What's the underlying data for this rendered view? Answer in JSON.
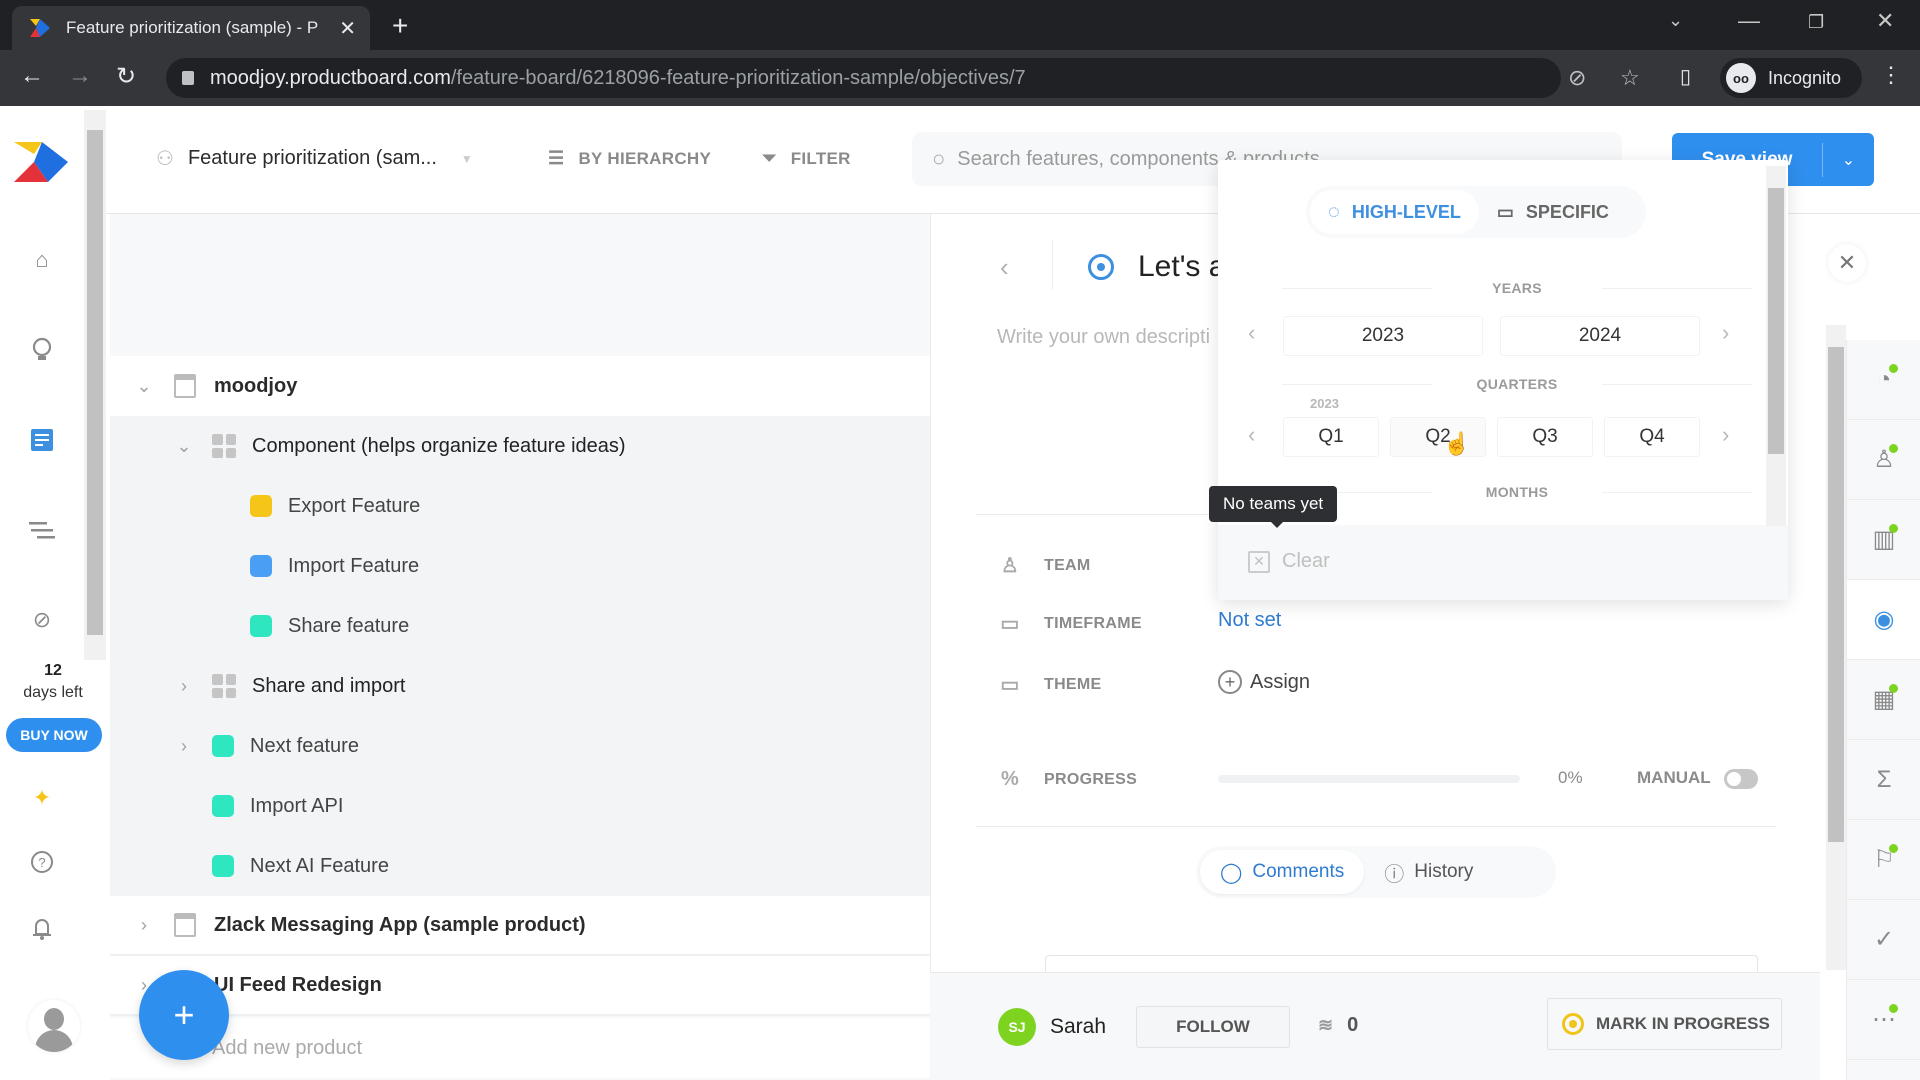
{
  "browser": {
    "tab_title": "Feature prioritization (sample) - P",
    "url_domain": "moodjoy.productboard.com",
    "url_path": "/feature-board/6218096-feature-prioritization-sample/objectives/7",
    "profile_label": "Incognito"
  },
  "rail": {
    "trial_days": "12",
    "trial_label": "days left",
    "buy_label": "BUY NOW"
  },
  "header": {
    "board_name": "Feature prioritization (sam...",
    "hierarchy_label": "BY HIERARCHY",
    "filter_label": "FILTER",
    "search_placeholder": "Search features, components & products",
    "save_view_label": "Save view"
  },
  "tree": {
    "rows": [
      {
        "label": "moodjoy",
        "type": "product",
        "expanded": true
      },
      {
        "label": "Component (helps organize feature ideas)",
        "type": "component",
        "expanded": true
      },
      {
        "label": "Export Feature",
        "type": "feature",
        "color": "#f5c518"
      },
      {
        "label": "Import Feature",
        "type": "feature",
        "color": "#4a9ff5"
      },
      {
        "label": "Share feature",
        "type": "feature",
        "color": "#2ee6c0"
      },
      {
        "label": "Share and import",
        "type": "component",
        "expanded": false
      },
      {
        "label": "Next feature",
        "type": "feature",
        "color": "#2ee6c0",
        "expandable": true
      },
      {
        "label": "Import API",
        "type": "feature",
        "color": "#2ee6c0"
      },
      {
        "label": "Next AI Feature",
        "type": "feature",
        "color": "#2ee6c0"
      },
      {
        "label": "Zlack Messaging App (sample product)",
        "type": "product",
        "expanded": false
      },
      {
        "label": "UI Feed Redesign",
        "type": "product",
        "expanded": false
      }
    ],
    "add_product_label": "Add new product"
  },
  "detail": {
    "title": "Let's a",
    "description_placeholder": "Write your own descripti",
    "fields": {
      "team_label": "TEAM",
      "timeframe_label": "TIMEFRAME",
      "timeframe_value": "Not set",
      "theme_label": "THEME",
      "theme_action": "Assign",
      "progress_label": "PROGRESS",
      "progress_value": "0%",
      "progress_fraction": 0,
      "manual_label": "MANUAL",
      "manual_on": false
    },
    "tabs": {
      "comments": "Comments",
      "history": "History",
      "active": "comments"
    },
    "footer": {
      "user_initials": "SJ",
      "user_name": "Sarah",
      "follow_label": "FOLLOW",
      "votes": "0",
      "mark_label": "MARK IN PROGRESS"
    }
  },
  "timeframe_picker": {
    "modes": {
      "high_level": "HIGH-LEVEL",
      "specific": "SPECIFIC",
      "active": "high_level"
    },
    "years_label": "YEARS",
    "years": [
      "2023",
      "2024"
    ],
    "quarters_label": "QUARTERS",
    "quarters_year": "2023",
    "quarters": [
      "Q1",
      "Q2",
      "Q3",
      "Q4"
    ],
    "hovered_quarter": "Q2",
    "months_label": "MONTHS",
    "clear_label": "Clear"
  },
  "tooltip": "No teams yet",
  "colors": {
    "accent": "#2f8fee",
    "link": "#2f7bd0",
    "notification_dot": "#7ed321",
    "in_progress": "#f0c419"
  }
}
